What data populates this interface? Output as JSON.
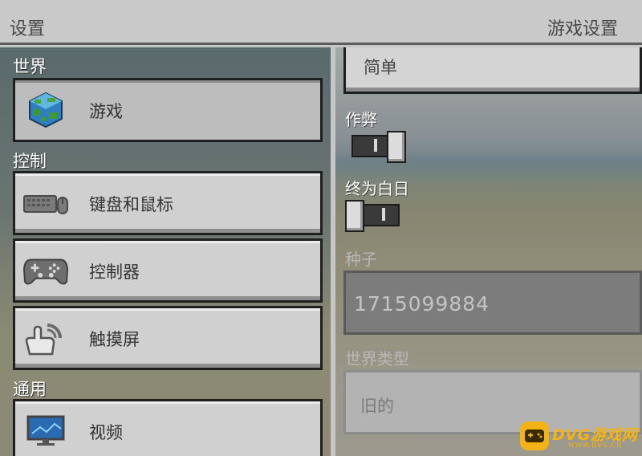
{
  "header": {
    "title": "设置",
    "subtitle": "游戏设置"
  },
  "sidebar": {
    "sections": [
      {
        "label": "世界",
        "items": [
          {
            "label": "游戏",
            "icon": "world-globe-icon",
            "selected": true
          }
        ]
      },
      {
        "label": "控制",
        "items": [
          {
            "label": "键盘和鼠标",
            "icon": "keyboard-mouse-icon"
          },
          {
            "label": "控制器",
            "icon": "gamepad-icon"
          },
          {
            "label": "触摸屏",
            "icon": "touch-hand-icon"
          }
        ]
      },
      {
        "label": "通用",
        "items": [
          {
            "label": "视频",
            "icon": "monitor-icon"
          }
        ]
      }
    ]
  },
  "panel": {
    "difficulty_value": "简单",
    "cheats": {
      "label": "作弊",
      "on": true
    },
    "always_day": {
      "label": "终为白日",
      "on": false
    },
    "seed": {
      "label": "种子",
      "value": "1715099884"
    },
    "world_type": {
      "label": "世界类型",
      "value": "旧的"
    }
  },
  "watermark": {
    "text": "DVG游戏网",
    "url": "WWW.DVG.CN"
  },
  "colors": {
    "watermark": "#f3b316",
    "button_face": "#d0d0d0",
    "button_border": "#1f1f1f"
  }
}
